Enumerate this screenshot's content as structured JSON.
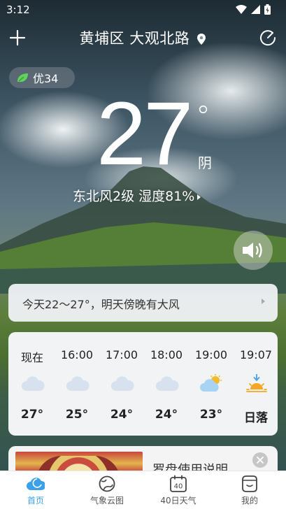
{
  "status_bar": {
    "time": "3:12"
  },
  "header": {
    "location": "黄埔区 大观北路"
  },
  "aqi": {
    "label": "优34"
  },
  "current": {
    "temperature": "27",
    "degree_symbol": "°",
    "condition": "阴",
    "wind_humidity": "东北风2级  湿度81%"
  },
  "summary": {
    "text": "今天22～27°，明天傍晚有大风"
  },
  "hourly": [
    {
      "time": "现在",
      "icon": "cloud-icon",
      "temp": "27°"
    },
    {
      "time": "16:00",
      "icon": "cloud-icon",
      "temp": "25°"
    },
    {
      "time": "17:00",
      "icon": "cloud-icon",
      "temp": "24°"
    },
    {
      "time": "18:00",
      "icon": "cloud-icon",
      "temp": "24°"
    },
    {
      "time": "19:00",
      "icon": "partly-cloudy-icon",
      "temp": "23°"
    },
    {
      "time": "19:07",
      "icon": "sunset-icon",
      "temp": "日落"
    }
  ],
  "news": {
    "title": "罗盘使用说明"
  },
  "nav": [
    {
      "label": "首页",
      "icon": "home-cloud-icon",
      "active": true
    },
    {
      "label": "气象云图",
      "icon": "cloud-map-icon",
      "active": false
    },
    {
      "label": "40日天气",
      "icon": "calendar-40-icon",
      "active": false
    },
    {
      "label": "我的",
      "icon": "profile-icon",
      "active": false
    }
  ],
  "colors": {
    "accent": "#3aa1e8",
    "aqi_leaf": "#5fd35b",
    "sun": "#f5a623"
  }
}
